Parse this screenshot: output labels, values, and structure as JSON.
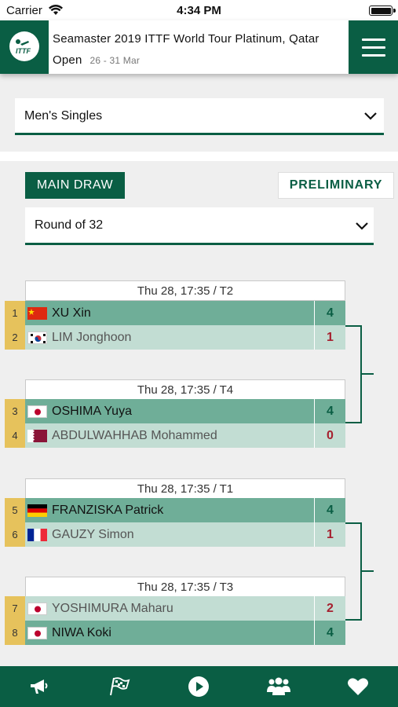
{
  "status_bar": {
    "carrier": "Carrier",
    "time": "4:34 PM"
  },
  "header": {
    "logo_text": "ITTF",
    "title": "Seamaster 2019 ITTF World Tour Platinum, Qatar Open",
    "dates": "26 - 31 Mar"
  },
  "event_select": {
    "value": "Men's Singles"
  },
  "draw_tabs": {
    "main_draw": "MAIN DRAW",
    "preliminary": "PRELIMINARY"
  },
  "round_select": {
    "value": "Round of 32"
  },
  "matches": [
    {
      "time": "Thu 28, 17:35 / T2",
      "players": [
        {
          "seed": "1",
          "name": "XU Xin",
          "flag": "CHN",
          "score": "4",
          "winner": true
        },
        {
          "seed": "2",
          "name": "LIM Jonghoon",
          "flag": "KOR",
          "score": "1",
          "winner": false
        }
      ]
    },
    {
      "time": "Thu 28, 17:35 / T4",
      "players": [
        {
          "seed": "3",
          "name": "OSHIMA Yuya",
          "flag": "JPN",
          "score": "4",
          "winner": true
        },
        {
          "seed": "4",
          "name": "ABDULWAHHAB Mohammed",
          "flag": "QAT",
          "score": "0",
          "winner": false
        }
      ]
    },
    {
      "time": "Thu 28, 17:35 / T1",
      "players": [
        {
          "seed": "5",
          "name": "FRANZISKA Patrick",
          "flag": "GER",
          "score": "4",
          "winner": true
        },
        {
          "seed": "6",
          "name": "GAUZY Simon",
          "flag": "FRA",
          "score": "1",
          "winner": false
        }
      ]
    },
    {
      "time": "Thu 28, 17:35 / T3",
      "players": [
        {
          "seed": "7",
          "name": "YOSHIMURA Maharu",
          "flag": "JPN",
          "score": "2",
          "winner": false
        },
        {
          "seed": "8",
          "name": "NIWA Koki",
          "flag": "JPN",
          "score": "4",
          "winner": true
        }
      ]
    }
  ],
  "tab_bar": [
    {
      "icon": "megaphone-icon"
    },
    {
      "icon": "flags-icon"
    },
    {
      "icon": "play-icon"
    },
    {
      "icon": "players-icon"
    },
    {
      "icon": "heart-icon"
    }
  ],
  "colors": {
    "brand_green": "#0a5e44",
    "winner_row": "#6fae98",
    "loser_row": "#c2ddd3",
    "seed_gold": "#e6c25c",
    "loss_score": "#a6202f"
  }
}
